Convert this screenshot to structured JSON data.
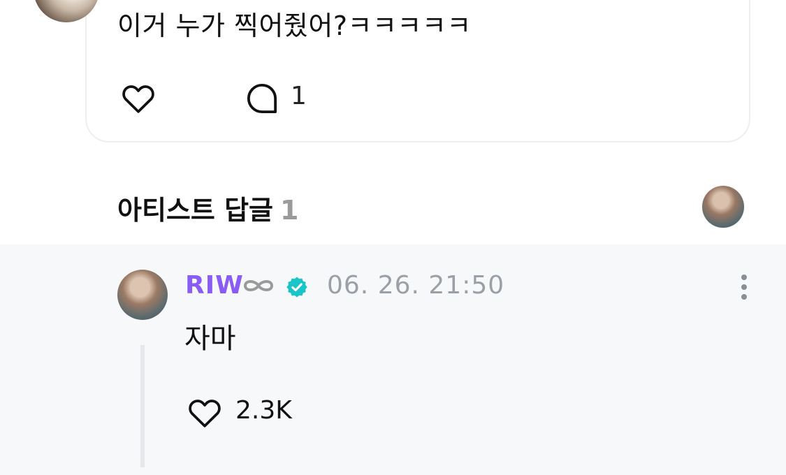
{
  "post": {
    "text": "이거 누가 찍어줬어?ㅋㅋㅋㅋㅋ",
    "comment_count": "1",
    "icons": {
      "like": "heart-icon",
      "comment": "comment-bubble-icon"
    }
  },
  "artist_replies": {
    "title": "아티스트 답글",
    "count": "1"
  },
  "reply": {
    "author": "RIW",
    "author_color": "#8a5cf6",
    "verified_color": "#19c5c8",
    "timestamp": "06. 26. 21:50",
    "text": "자마",
    "like_count": "2.3K",
    "icons": {
      "badge": "verified-badge-icon",
      "more": "more-vertical-icon",
      "like": "heart-icon"
    }
  }
}
